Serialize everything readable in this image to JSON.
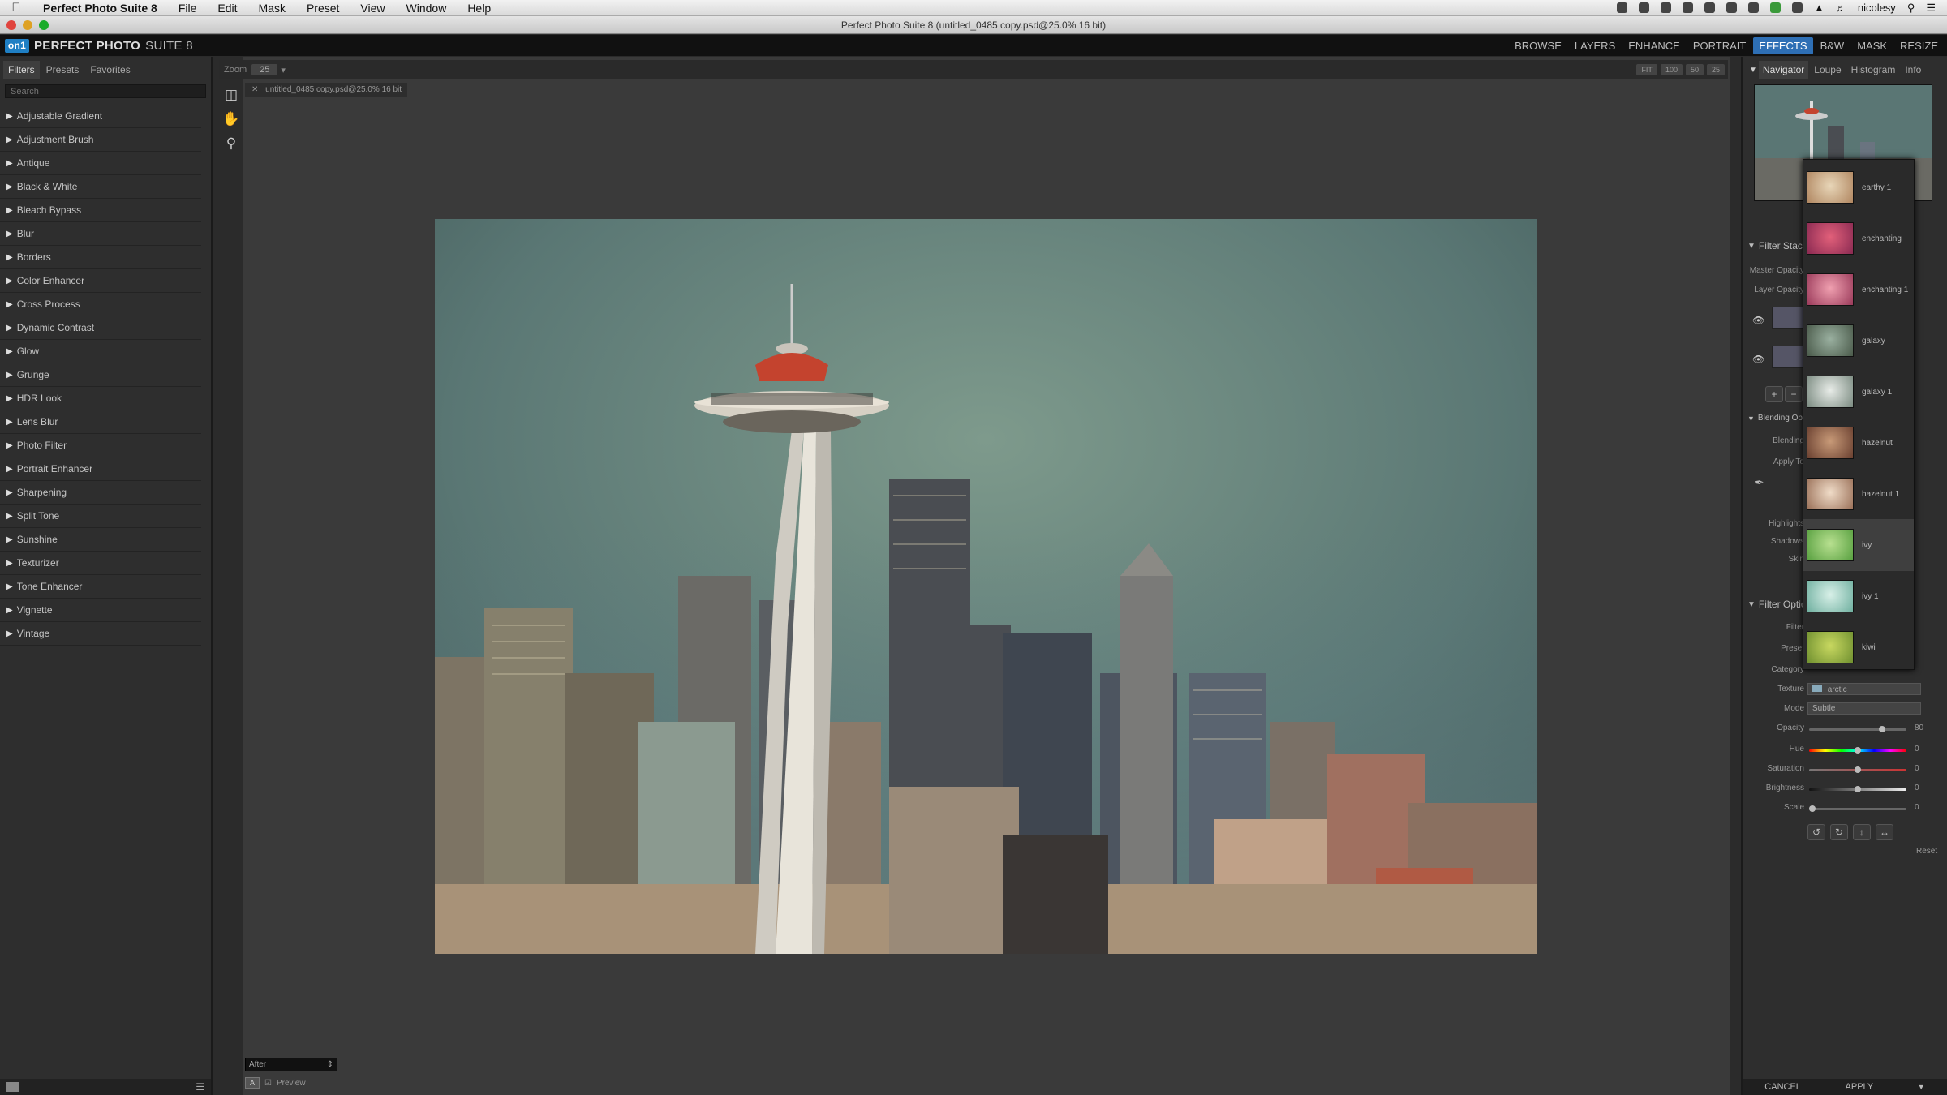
{
  "menubar": {
    "app_name": "Perfect Photo Suite 8",
    "items": [
      "File",
      "Edit",
      "Mask",
      "Preset",
      "View",
      "Window",
      "Help"
    ],
    "user": "nicolesy"
  },
  "window": {
    "title": "Perfect Photo Suite 8 (untitled_0485 copy.psd@25.0% 16 bit)"
  },
  "appbar": {
    "logo_mark": "on1",
    "logo_text": "PERFECT PHOTO",
    "logo_suffix": "SUITE 8",
    "modules": [
      {
        "label": "BROWSE",
        "active": false
      },
      {
        "label": "LAYERS",
        "active": false
      },
      {
        "label": "ENHANCE",
        "active": false
      },
      {
        "label": "PORTRAIT",
        "active": false
      },
      {
        "label": "EFFECTS",
        "active": true
      },
      {
        "label": "B&W",
        "active": false
      },
      {
        "label": "MASK",
        "active": false
      },
      {
        "label": "RESIZE",
        "active": false
      }
    ]
  },
  "left_panel": {
    "tabs": [
      "Filters",
      "Presets",
      "Favorites"
    ],
    "search_placeholder": "Search",
    "filters": [
      "Adjustable Gradient",
      "Adjustment Brush",
      "Antique",
      "Black & White",
      "Bleach Bypass",
      "Blur",
      "Borders",
      "Color Enhancer",
      "Cross Process",
      "Dynamic Contrast",
      "Glow",
      "Grunge",
      "HDR Look",
      "Lens Blur",
      "Photo Filter",
      "Portrait Enhancer",
      "Sharpening",
      "Split Tone",
      "Sunshine",
      "Texturizer",
      "Tone Enhancer",
      "Vignette",
      "Vintage"
    ]
  },
  "canvas": {
    "zoom_label": "Zoom",
    "zoom_value": "25",
    "zoom_buttons": [
      "FIT",
      "100",
      "50",
      "25"
    ],
    "doc_tab": "untitled_0485 copy.psd@25.0% 16 bit",
    "view_mode": "After",
    "preview_label": "Preview"
  },
  "right_panel": {
    "tabs": [
      "Navigator",
      "Loupe",
      "Histogram",
      "Info"
    ],
    "filter_stack_title": "Filter Stack",
    "master_opacity_label": "Master Opacity",
    "layer_opacity_label": "Layer Opacity",
    "blending_section": "Blending Options",
    "blending_label": "Blending",
    "apply_to_label": "Apply To",
    "highlights_label": "Highlights",
    "shadows_label": "Shadows",
    "skin_label": "Skin",
    "filter_options_title": "Filter Options",
    "filter_label": "Filter",
    "preset_label": "Preset",
    "category_label": "Category",
    "texture_label": "Texture",
    "texture_value": "arctic",
    "mode_label": "Mode",
    "mode_value": "Subtle",
    "opacity_label": "Opacity",
    "opacity_value": "80",
    "hue_label": "Hue",
    "hue_value": "0",
    "saturation_label": "Saturation",
    "saturation_value": "0",
    "brightness_label": "Brightness",
    "brightness_value": "0",
    "scale_label": "Scale",
    "scale_value": "0",
    "reset_label": "Reset",
    "cancel_label": "CANCEL",
    "apply_label": "APPLY"
  },
  "texture_dropdown": {
    "items": [
      {
        "label": "earthy 1",
        "colors": [
          "#e8d6b8",
          "#b08660"
        ]
      },
      {
        "label": "enchanting",
        "colors": [
          "#e2607a",
          "#8a2a52"
        ]
      },
      {
        "label": "enchanting 1",
        "colors": [
          "#f0a0b0",
          "#9a3a5a"
        ]
      },
      {
        "label": "galaxy",
        "colors": [
          "#9ab0a0",
          "#4a5a4a"
        ]
      },
      {
        "label": "galaxy 1",
        "colors": [
          "#e8ece8",
          "#7a8a80"
        ]
      },
      {
        "label": "hazelnut",
        "colors": [
          "#c89a78",
          "#6a4030"
        ]
      },
      {
        "label": "hazelnut 1",
        "colors": [
          "#f0dcc8",
          "#9a7058"
        ]
      },
      {
        "label": "ivy",
        "colors": [
          "#b8e090",
          "#58a040"
        ]
      },
      {
        "label": "ivy 1",
        "colors": [
          "#d8f0e8",
          "#70b0a0"
        ]
      },
      {
        "label": "kiwi",
        "colors": [
          "#c8d860",
          "#709030"
        ]
      }
    ],
    "hover_index": 7
  },
  "colors": {
    "accent": "#2e6fb5",
    "panel": "#2e2e2e",
    "workspace": "#3a3a3a"
  }
}
